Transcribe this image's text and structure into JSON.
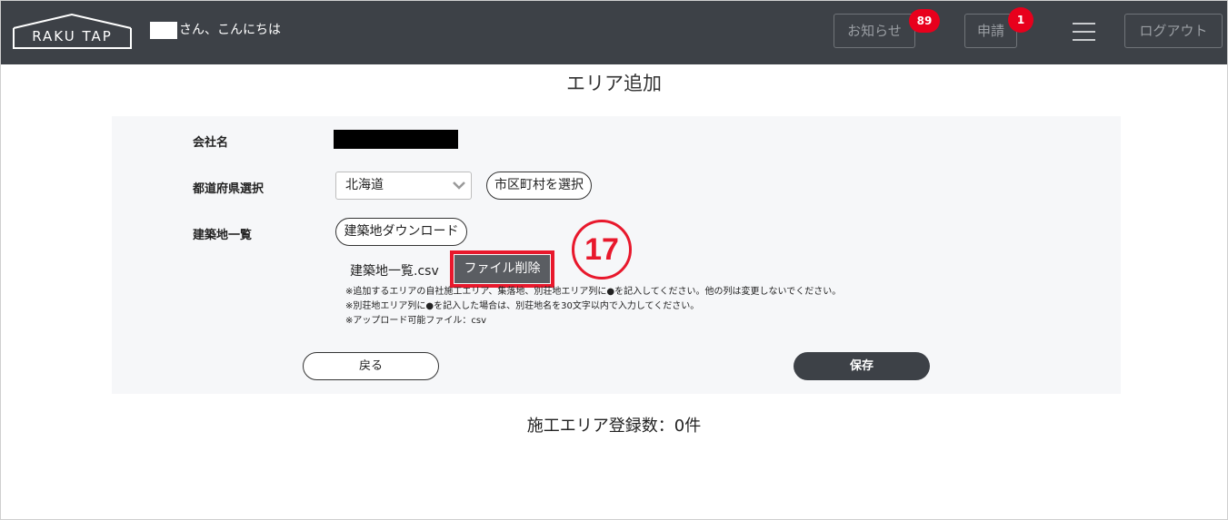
{
  "header": {
    "logo": "RAKU TAP",
    "greeting": "さん、こんにちは",
    "notice_label": "お知らせ",
    "notice_count": "89",
    "request_label": "申請",
    "request_count": "1",
    "logout_label": "ログアウト"
  },
  "page": {
    "title": "エリア追加",
    "registered_count": "施工エリア登録数：0件"
  },
  "form": {
    "company_label": "会社名",
    "prefecture_label": "都道府県選択",
    "prefecture_value": "北海道",
    "city_select_button": "市区町村を選択",
    "site_list_label": "建築地一覧",
    "download_button": "建築地ダウンロード",
    "file_name": "建築地一覧.csv",
    "delete_file_button": "ファイル削除",
    "step_number": "17",
    "notes": [
      "※追加するエリアの自社施工エリア、集落地、別荘地エリア列に●を記入してください。他の列は変更しないでください。",
      "※別荘地エリア列に●を記入した場合は、別荘地名を30文字以内で入力してください。",
      "※アップロード可能ファイル：csv"
    ],
    "back_button": "戻る",
    "save_button": "保存"
  },
  "colors": {
    "header_bg": "#3d4147",
    "badge_red": "#e8001c",
    "highlight_red": "#e8182c",
    "panel_bg": "#f6f7f9"
  }
}
